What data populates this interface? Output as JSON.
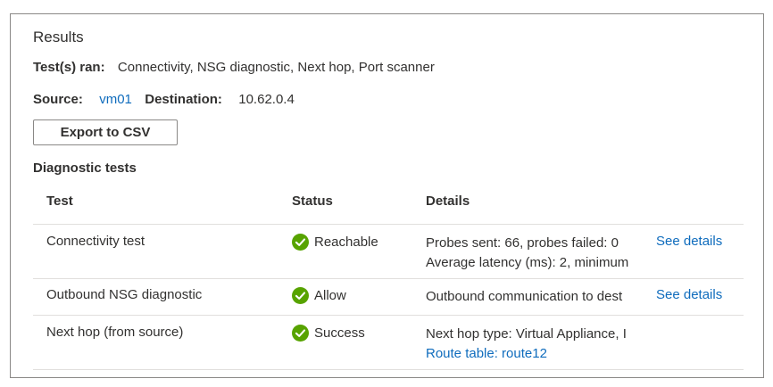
{
  "results": {
    "title": "Results",
    "tests_ran_label": "Test(s) ran:",
    "tests_ran_value": "Connectivity, NSG diagnostic, Next hop, Port scanner",
    "source_label": "Source:",
    "source_value": "vm01",
    "destination_label": "Destination:",
    "destination_value": "10.62.0.4",
    "export_label": "Export to CSV"
  },
  "diagnostics": {
    "title": "Diagnostic tests",
    "columns": [
      "Test",
      "Status",
      "Details"
    ],
    "rows": [
      {
        "test": "Connectivity test",
        "status": "Reachable",
        "details": [
          "Probes sent: 66, probes failed: 0",
          "Average latency (ms): 2, minimum"
        ],
        "link": "See details"
      },
      {
        "test": "Outbound NSG diagnostic",
        "status": "Allow",
        "details": [
          "Outbound communication to dest"
        ],
        "link": "See details"
      },
      {
        "test": "Next hop (from source)",
        "status": "Success",
        "details": [
          "Next hop type: Virtual Appliance, I"
        ],
        "details_link": "Route table: route12"
      }
    ]
  },
  "colors": {
    "success": "#57a300",
    "link": "#0f6cbd",
    "text": "#323130",
    "border": "#8a8886",
    "divider": "#e1dfdd"
  },
  "icons": {
    "status": "check-circle-icon"
  }
}
